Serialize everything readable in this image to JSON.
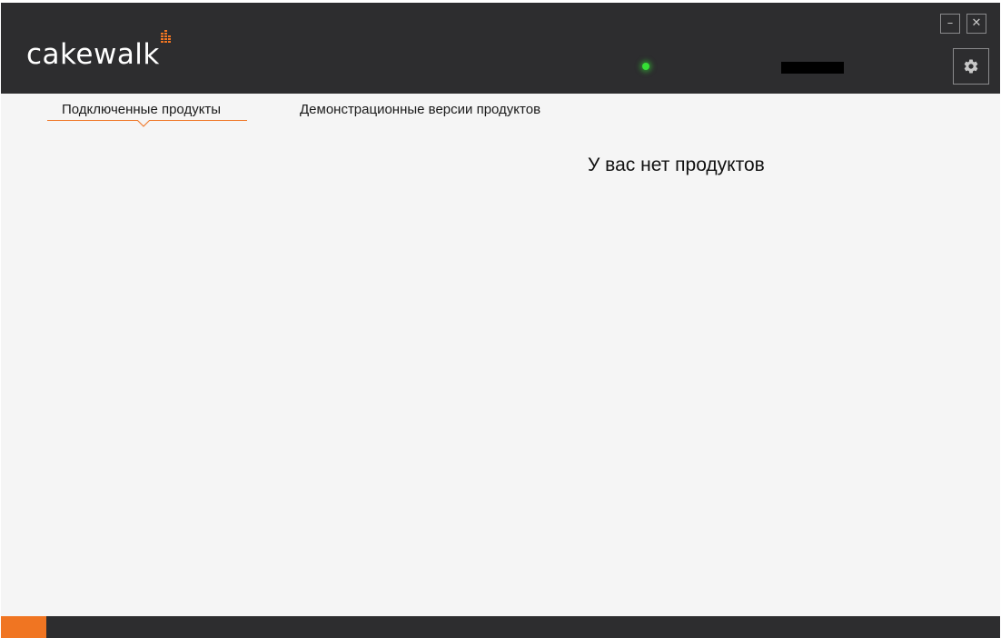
{
  "app": {
    "logo_text": "cakewalk",
    "accent_color": "#f07522",
    "header_color": "#2d2d2f",
    "status_color": "#35e035"
  },
  "header": {
    "user_name": "",
    "minimize_label": "–",
    "close_label": "✕",
    "settings_icon": "gear-icon"
  },
  "tabs": [
    {
      "label": "Подключенные продукты",
      "active": true
    },
    {
      "label": "Демонстрационные версии продуктов",
      "active": false
    }
  ],
  "main": {
    "empty_message": "У вас нет продуктов"
  },
  "footer": {
    "progress_fraction": 0.045
  }
}
